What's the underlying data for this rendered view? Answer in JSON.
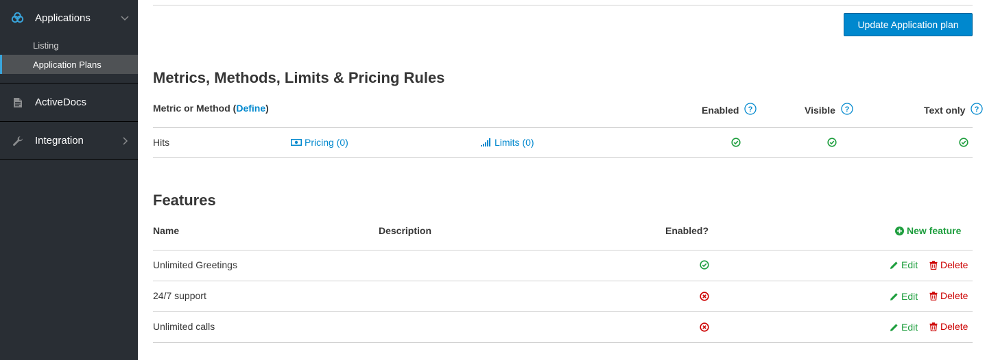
{
  "sidebar": {
    "sections": [
      {
        "label": "Applications",
        "icon": "applications-icon",
        "expanded": true
      },
      {
        "label": "ActiveDocs",
        "icon": "document-icon"
      },
      {
        "label": "Integration",
        "icon": "wrench-icon"
      }
    ],
    "sub_items": [
      {
        "label": "Listing"
      },
      {
        "label": "Application Plans",
        "active": true
      }
    ]
  },
  "actions": {
    "update_label": "Update Application plan"
  },
  "metrics": {
    "title": "Metrics, Methods, Limits & Pricing Rules",
    "header_metric_prefix": "Metric or Method (",
    "header_define": "Define",
    "header_metric_suffix": ")",
    "header_enabled": "Enabled",
    "header_visible": "Visible",
    "header_text_only": "Text only",
    "rows": [
      {
        "name": "Hits",
        "pricing": "Pricing (0)",
        "limits": "Limits (0)",
        "enabled": true,
        "visible": true,
        "text_only": true
      }
    ]
  },
  "features": {
    "title": "Features",
    "header_name": "Name",
    "header_description": "Description",
    "header_enabled": "Enabled?",
    "new_feature": "New feature",
    "edit_label": "Edit",
    "delete_label": "Delete",
    "rows": [
      {
        "name": "Unlimited Greetings",
        "enabled": true
      },
      {
        "name": "24/7 support",
        "enabled": false
      },
      {
        "name": "Unlimited calls",
        "enabled": false
      }
    ]
  },
  "colors": {
    "sidebar_bg": "#292e34",
    "accent": "#0088ce",
    "success": "#1e9e3e",
    "danger": "#cc0000"
  }
}
